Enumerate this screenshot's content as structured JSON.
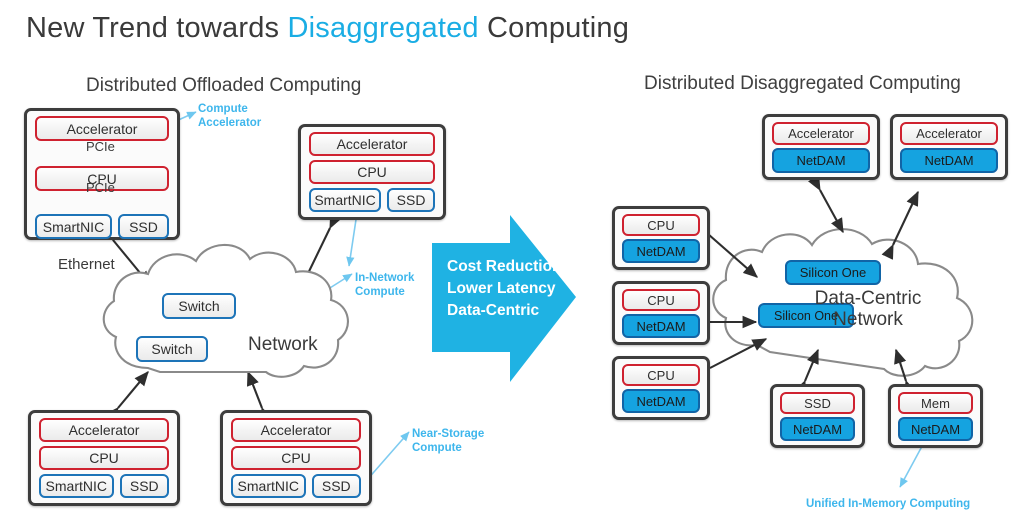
{
  "title": {
    "before": "New Trend towards ",
    "highlight": "Disaggregated",
    "after": " Computing",
    "highlight_color": "#1aade4"
  },
  "panels": {
    "left_title": "Distributed Offloaded Computing",
    "right_title": "Distributed Disaggregated Computing"
  },
  "colors": {
    "cyan": "#15a3e0",
    "callout_cyan": "#3eb6ec",
    "red_border": "#cf2230",
    "blue_border": "#1d74b8",
    "chassis": "#3d3d3d",
    "arrow_fill": "#1fb2e3",
    "text": "#3a3a3a"
  },
  "left": {
    "nodes": [
      {
        "id": "node-top-left",
        "chips": [
          "Accelerator",
          "CPU",
          "SmartNIC",
          "SSD"
        ],
        "bus_labels": [
          "PCIe",
          "PCIe"
        ]
      },
      {
        "id": "node-top-mid",
        "chips": [
          "Accelerator",
          "CPU",
          "SmartNIC",
          "SSD"
        ]
      },
      {
        "id": "node-bottom-left",
        "chips": [
          "Accelerator",
          "CPU",
          "SmartNIC",
          "SSD"
        ]
      },
      {
        "id": "node-bottom-mid",
        "chips": [
          "Accelerator",
          "CPU",
          "SmartNIC",
          "SSD"
        ]
      }
    ],
    "link_label": "Ethernet",
    "cloud": {
      "label": "Network",
      "boxes": [
        "Switch",
        "Switch"
      ]
    },
    "callouts": [
      {
        "id": "compute-accelerator",
        "lines": [
          "Compute",
          "Accelerator"
        ]
      },
      {
        "id": "in-network-compute",
        "lines": [
          "In-Network",
          "Compute"
        ]
      },
      {
        "id": "near-storage-compute",
        "lines": [
          "Near-Storage",
          "Compute"
        ]
      }
    ]
  },
  "transition_arrow": {
    "lines": [
      "Cost Reduction",
      "Lower Latency",
      "Data-Centric"
    ]
  },
  "right": {
    "nodes": [
      {
        "id": "acc-netdam-1",
        "top": "Accelerator",
        "bottom": "NetDAM"
      },
      {
        "id": "acc-netdam-2",
        "top": "Accelerator",
        "bottom": "NetDAM"
      },
      {
        "id": "cpu-netdam-1",
        "top": "CPU",
        "bottom": "NetDAM"
      },
      {
        "id": "cpu-netdam-2",
        "top": "CPU",
        "bottom": "NetDAM"
      },
      {
        "id": "cpu-netdam-3",
        "top": "CPU",
        "bottom": "NetDAM"
      },
      {
        "id": "ssd-netdam",
        "top": "SSD",
        "bottom": "NetDAM"
      },
      {
        "id": "mem-netdam",
        "top": "Mem",
        "bottom": "NetDAM"
      }
    ],
    "cloud": {
      "label_line1": "Data-Centric",
      "label_line2": "Network",
      "boxes": [
        "Silicon One",
        "Silicon One"
      ]
    },
    "callouts": [
      {
        "id": "unified-in-memory",
        "text": "Unified In-Memory Computing"
      }
    ]
  }
}
